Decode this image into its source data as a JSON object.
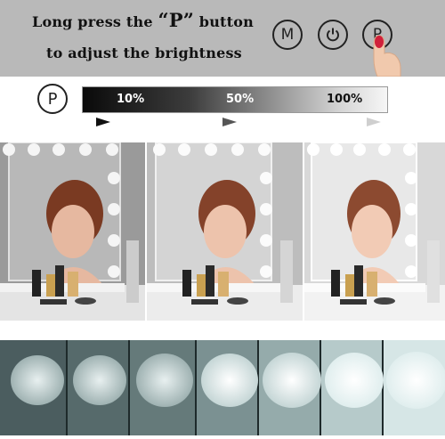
{
  "banner": {
    "line1_prefix": "Long press the ",
    "line1_key": "“P”",
    "line1_suffix": " button",
    "line2": "to adjust the brightness",
    "buttons": [
      {
        "label": "M",
        "icon": "m-button-icon"
      },
      {
        "label": "",
        "icon": "power-icon"
      },
      {
        "label": "P",
        "icon": "p-button-icon"
      }
    ]
  },
  "brightness": {
    "p_label": "P",
    "levels": [
      "10%",
      "50%",
      "100%"
    ]
  },
  "colors": {
    "banner_bg": "#b9b9b9",
    "finger_nail": "#d0203a",
    "light_glow": "#e8f4f4",
    "strip_bg": "#3c4a4c"
  },
  "photos": [
    {
      "brightness": 0.1
    },
    {
      "brightness": 0.5
    },
    {
      "brightness": 1.0
    }
  ]
}
